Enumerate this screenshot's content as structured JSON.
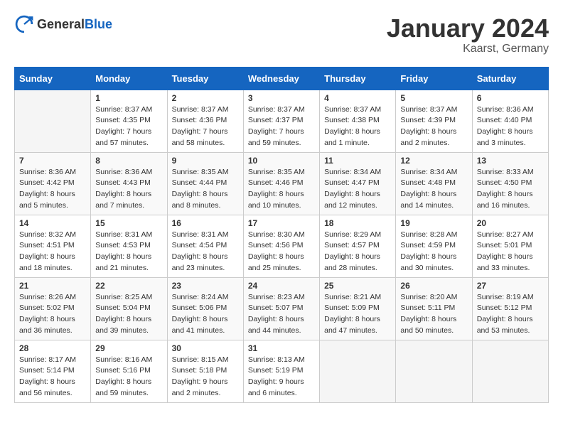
{
  "header": {
    "logo_general": "General",
    "logo_blue": "Blue",
    "month": "January 2024",
    "location": "Kaarst, Germany"
  },
  "days_of_week": [
    "Sunday",
    "Monday",
    "Tuesday",
    "Wednesday",
    "Thursday",
    "Friday",
    "Saturday"
  ],
  "weeks": [
    [
      {
        "day": "",
        "sunrise": "",
        "sunset": "",
        "daylight": ""
      },
      {
        "day": "1",
        "sunrise": "Sunrise: 8:37 AM",
        "sunset": "Sunset: 4:35 PM",
        "daylight": "Daylight: 7 hours and 57 minutes."
      },
      {
        "day": "2",
        "sunrise": "Sunrise: 8:37 AM",
        "sunset": "Sunset: 4:36 PM",
        "daylight": "Daylight: 7 hours and 58 minutes."
      },
      {
        "day": "3",
        "sunrise": "Sunrise: 8:37 AM",
        "sunset": "Sunset: 4:37 PM",
        "daylight": "Daylight: 7 hours and 59 minutes."
      },
      {
        "day": "4",
        "sunrise": "Sunrise: 8:37 AM",
        "sunset": "Sunset: 4:38 PM",
        "daylight": "Daylight: 8 hours and 1 minute."
      },
      {
        "day": "5",
        "sunrise": "Sunrise: 8:37 AM",
        "sunset": "Sunset: 4:39 PM",
        "daylight": "Daylight: 8 hours and 2 minutes."
      },
      {
        "day": "6",
        "sunrise": "Sunrise: 8:36 AM",
        "sunset": "Sunset: 4:40 PM",
        "daylight": "Daylight: 8 hours and 3 minutes."
      }
    ],
    [
      {
        "day": "7",
        "sunrise": "Sunrise: 8:36 AM",
        "sunset": "Sunset: 4:42 PM",
        "daylight": "Daylight: 8 hours and 5 minutes."
      },
      {
        "day": "8",
        "sunrise": "Sunrise: 8:36 AM",
        "sunset": "Sunset: 4:43 PM",
        "daylight": "Daylight: 8 hours and 7 minutes."
      },
      {
        "day": "9",
        "sunrise": "Sunrise: 8:35 AM",
        "sunset": "Sunset: 4:44 PM",
        "daylight": "Daylight: 8 hours and 8 minutes."
      },
      {
        "day": "10",
        "sunrise": "Sunrise: 8:35 AM",
        "sunset": "Sunset: 4:46 PM",
        "daylight": "Daylight: 8 hours and 10 minutes."
      },
      {
        "day": "11",
        "sunrise": "Sunrise: 8:34 AM",
        "sunset": "Sunset: 4:47 PM",
        "daylight": "Daylight: 8 hours and 12 minutes."
      },
      {
        "day": "12",
        "sunrise": "Sunrise: 8:34 AM",
        "sunset": "Sunset: 4:48 PM",
        "daylight": "Daylight: 8 hours and 14 minutes."
      },
      {
        "day": "13",
        "sunrise": "Sunrise: 8:33 AM",
        "sunset": "Sunset: 4:50 PM",
        "daylight": "Daylight: 8 hours and 16 minutes."
      }
    ],
    [
      {
        "day": "14",
        "sunrise": "Sunrise: 8:32 AM",
        "sunset": "Sunset: 4:51 PM",
        "daylight": "Daylight: 8 hours and 18 minutes."
      },
      {
        "day": "15",
        "sunrise": "Sunrise: 8:31 AM",
        "sunset": "Sunset: 4:53 PM",
        "daylight": "Daylight: 8 hours and 21 minutes."
      },
      {
        "day": "16",
        "sunrise": "Sunrise: 8:31 AM",
        "sunset": "Sunset: 4:54 PM",
        "daylight": "Daylight: 8 hours and 23 minutes."
      },
      {
        "day": "17",
        "sunrise": "Sunrise: 8:30 AM",
        "sunset": "Sunset: 4:56 PM",
        "daylight": "Daylight: 8 hours and 25 minutes."
      },
      {
        "day": "18",
        "sunrise": "Sunrise: 8:29 AM",
        "sunset": "Sunset: 4:57 PM",
        "daylight": "Daylight: 8 hours and 28 minutes."
      },
      {
        "day": "19",
        "sunrise": "Sunrise: 8:28 AM",
        "sunset": "Sunset: 4:59 PM",
        "daylight": "Daylight: 8 hours and 30 minutes."
      },
      {
        "day": "20",
        "sunrise": "Sunrise: 8:27 AM",
        "sunset": "Sunset: 5:01 PM",
        "daylight": "Daylight: 8 hours and 33 minutes."
      }
    ],
    [
      {
        "day": "21",
        "sunrise": "Sunrise: 8:26 AM",
        "sunset": "Sunset: 5:02 PM",
        "daylight": "Daylight: 8 hours and 36 minutes."
      },
      {
        "day": "22",
        "sunrise": "Sunrise: 8:25 AM",
        "sunset": "Sunset: 5:04 PM",
        "daylight": "Daylight: 8 hours and 39 minutes."
      },
      {
        "day": "23",
        "sunrise": "Sunrise: 8:24 AM",
        "sunset": "Sunset: 5:06 PM",
        "daylight": "Daylight: 8 hours and 41 minutes."
      },
      {
        "day": "24",
        "sunrise": "Sunrise: 8:23 AM",
        "sunset": "Sunset: 5:07 PM",
        "daylight": "Daylight: 8 hours and 44 minutes."
      },
      {
        "day": "25",
        "sunrise": "Sunrise: 8:21 AM",
        "sunset": "Sunset: 5:09 PM",
        "daylight": "Daylight: 8 hours and 47 minutes."
      },
      {
        "day": "26",
        "sunrise": "Sunrise: 8:20 AM",
        "sunset": "Sunset: 5:11 PM",
        "daylight": "Daylight: 8 hours and 50 minutes."
      },
      {
        "day": "27",
        "sunrise": "Sunrise: 8:19 AM",
        "sunset": "Sunset: 5:12 PM",
        "daylight": "Daylight: 8 hours and 53 minutes."
      }
    ],
    [
      {
        "day": "28",
        "sunrise": "Sunrise: 8:17 AM",
        "sunset": "Sunset: 5:14 PM",
        "daylight": "Daylight: 8 hours and 56 minutes."
      },
      {
        "day": "29",
        "sunrise": "Sunrise: 8:16 AM",
        "sunset": "Sunset: 5:16 PM",
        "daylight": "Daylight: 8 hours and 59 minutes."
      },
      {
        "day": "30",
        "sunrise": "Sunrise: 8:15 AM",
        "sunset": "Sunset: 5:18 PM",
        "daylight": "Daylight: 9 hours and 2 minutes."
      },
      {
        "day": "31",
        "sunrise": "Sunrise: 8:13 AM",
        "sunset": "Sunset: 5:19 PM",
        "daylight": "Daylight: 9 hours and 6 minutes."
      },
      {
        "day": "",
        "sunrise": "",
        "sunset": "",
        "daylight": ""
      },
      {
        "day": "",
        "sunrise": "",
        "sunset": "",
        "daylight": ""
      },
      {
        "day": "",
        "sunrise": "",
        "sunset": "",
        "daylight": ""
      }
    ]
  ]
}
